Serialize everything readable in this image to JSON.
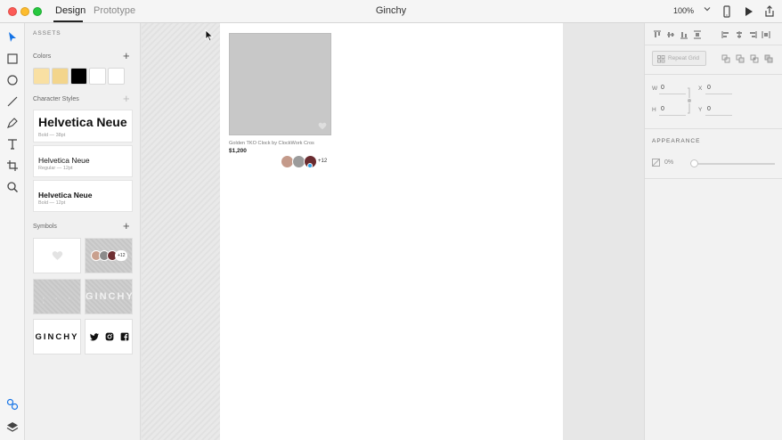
{
  "titlebar": {
    "tabs": [
      {
        "label": "Design",
        "active": true
      },
      {
        "label": "Prototype",
        "active": false
      }
    ],
    "document_title": "Ginchy",
    "zoom": "100%",
    "icons": [
      "mobile-preview-icon",
      "play-icon",
      "share-icon"
    ]
  },
  "tools": [
    "select-icon",
    "rectangle-icon",
    "ellipse-icon",
    "line-icon",
    "pen-icon",
    "text-icon",
    "artboard-icon",
    "zoom-icon",
    "assets-icon",
    "layers-icon"
  ],
  "assets": {
    "title": "ASSETS",
    "colors": {
      "label": "Colors",
      "swatches": [
        "#f9e0a3",
        "#f3d58c",
        "#000000",
        "#ffffff",
        "#ffffff"
      ]
    },
    "character_styles": {
      "label": "Character Styles",
      "items": [
        {
          "name": "Helvetica Neue",
          "meta": "Bold — 38pt"
        },
        {
          "name": "Helvetica Neue",
          "meta": "Regular — 12pt"
        },
        {
          "name": "Helvetica Neue",
          "meta": "Bold — 12pt"
        }
      ]
    },
    "symbols": {
      "label": "Symbols",
      "more_count": "+12",
      "logo_text": "GINCHY",
      "logo_text_dark": "GINCHY"
    }
  },
  "canvas": {
    "product": {
      "title": "Golden TKO Clock by ClockWork Cros",
      "price": "$1,200",
      "more_count": "+12"
    }
  },
  "properties": {
    "repeat_grid_label": "Repeat Grid",
    "fields": {
      "w_label": "W",
      "w_value": "0",
      "x_label": "X",
      "x_value": "0",
      "h_label": "H",
      "h_value": "0",
      "y_label": "Y",
      "y_value": "0"
    },
    "appearance": {
      "title": "APPEARANCE",
      "opacity": "0%"
    }
  }
}
